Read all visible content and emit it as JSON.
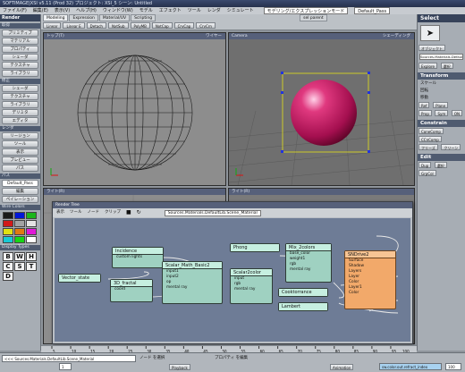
{
  "titlebar": {
    "text": "SOFTIMAGE|XSI v5.11 (Prod 32) プロジェクト: XSI_5  シーン: Untitled"
  },
  "menubar": {
    "items": [
      "ファイル(F)",
      "編集(E)",
      "表示(V)",
      "ヘルプ(H)",
      "ウィンドウ(W)",
      "ヘルプ(H)",
      "モデル",
      "エフェクト",
      "ツール",
      "レンダ",
      "シミュレート"
    ],
    "mode": "モデリング/エクスプレッションモード",
    "pass": "Default_Pass"
  },
  "left_panel": {
    "header": "Render",
    "sections": [
      {
        "title": "取得",
        "buttons": [
          "プリミティブ",
          "マテリアル",
          "プロパティ",
          "シェーダ",
          "テクスチャ",
          "ライブラリ"
        ]
      },
      {
        "title": "修正",
        "buttons": [
          "シェーダ",
          "テクスチャ",
          "ライブラリ"
        ]
      },
      {
        "title": "Render",
        "buttons": [
          "デリミタ",
          "エディタ"
        ]
      },
      {
        "title": "レンダ",
        "buttons": [
          "リージョン",
          "ツール",
          "表示",
          "プレビュー",
          "パス"
        ]
      }
    ],
    "pass_section": {
      "title": "パス",
      "pass_name": "Default_Pass",
      "buttons": [
        "編集",
        "ペイレーション"
      ]
    },
    "wire_colors": {
      "title": "Wire Colors",
      "swatches": [
        "#1a1a1a",
        "#0017d9",
        "#1bb51b",
        "#d11a1a",
        "#a3a3a3",
        "#e3e3e3",
        "#e0e012",
        "#e07a12",
        "#e01ad8",
        "#17c9d6",
        "#17d615",
        "#ffffff"
      ]
    },
    "display_types": {
      "title": "Display Types",
      "letters": [
        "B",
        "W",
        "H",
        "C",
        "S",
        "T",
        "D"
      ]
    }
  },
  "toolbar": {
    "tabs": [
      "Modeling",
      "Expression",
      "Material/UV",
      "Scripting"
    ],
    "buttons": [
      "Linear",
      "Linear E",
      "Detach",
      "NxtSub",
      "PolyMB",
      "NxtCap",
      "CrvCap",
      "CrvCrn"
    ],
    "right_label": "sel parent"
  },
  "viewports": {
    "top_left": {
      "title": "トップ(T)",
      "label": "ワイヤー"
    },
    "top_right": {
      "title": "Camera",
      "label": "シェーディング"
    },
    "bottom_left": {
      "title": "ライト(R)"
    },
    "bottom_right": {
      "title": "ライト(R)"
    }
  },
  "render_tree": {
    "title": "Render Tree",
    "menu": [
      "表示",
      "ツール",
      "ノード",
      "クリップ"
    ],
    "path": "Sources.Materials.DefaultLib.Scene_Material",
    "nodes": [
      {
        "title": "Incidence",
        "ports": [
          "custom lights"
        ]
      },
      {
        "title": "Vector_state",
        "ports": []
      },
      {
        "title": "3D_fractal",
        "ports": [
          "coord"
        ]
      },
      {
        "title": "Scalar_Math_Basic2",
        "ports": [
          "input1",
          "input2",
          "op",
          "mental ray"
        ]
      },
      {
        "title": "Scalar2color",
        "ports": [
          "input",
          "rgb",
          "mental ray"
        ]
      },
      {
        "title": "Phong",
        "ports": []
      },
      {
        "title": "Mix_2colors",
        "ports": [
          "base_color",
          "weight1",
          "rgb",
          "mental ray"
        ]
      },
      {
        "title": "Cooktorrance",
        "ports": []
      },
      {
        "title": "Lambert",
        "ports": []
      },
      {
        "title": "SNDrive2",
        "ports": [
          "Surface",
          "Shadow",
          "Layers",
          "Layer",
          "Color",
          "Layer1",
          "Color"
        ]
      }
    ]
  },
  "right_panel": {
    "header": "Select",
    "object_label": "オブジェクト",
    "sources_field": "Sources.Materials.DefaultLib",
    "explore_buttons": [
      "Explore",
      "選択"
    ],
    "transform": {
      "title": "Transform",
      "scale": "スケール",
      "rotation": "回転",
      "translation": "移動",
      "buttons": [
        "Ref",
        "Plane",
        "Prop",
        "Sym",
        "Snap",
        "Ref"
      ]
    },
    "constrain": {
      "title": "Constrain",
      "buttons": [
        "ConeComp",
        "CCnComp",
        "フリーズ",
        "クリーン",
        "Ref"
      ]
    },
    "edit": {
      "title": "Edit",
      "buttons": [
        "Dup",
        "選択",
        "GrpCol",
        "Ref"
      ]
    },
    "snap": {
      "title": "Snap",
      "on": "ON",
      "buttons": [
        "Dup",
        "GrpCol",
        "選択"
      ]
    }
  },
  "timebar": {
    "ticks": [
      "5",
      "10",
      "15",
      "20",
      "25",
      "30",
      "35",
      "40",
      "45",
      "50",
      "55",
      "60",
      "65",
      "70",
      "75",
      "80",
      "85",
      "90",
      "95"
    ],
    "end_frame": "100"
  },
  "status": {
    "field_left": "<<< Sources.Materials.DefaultLib.Scene_Material",
    "playback": "Playback",
    "autokey": "Animation",
    "field_right": "sw.color.out.refract_index",
    "frame": "1",
    "end_frame": "100",
    "hints": [
      "ノード を選択",
      "プロパティ を編集"
    ]
  }
}
